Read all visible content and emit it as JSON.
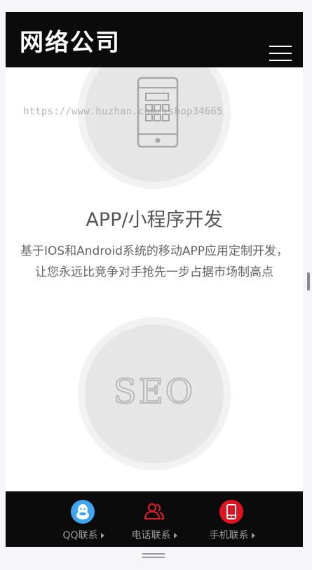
{
  "header": {
    "logo_text": "网络公司"
  },
  "watermark": "https://www.huzhan.com/ishop34665",
  "services": [
    {
      "title": "APP/小程序开发",
      "description": "基于IOS和Android系统的移动APP应用定制开发，让您永远比竞争对手抢先一步占据市场制高点",
      "icon": "mobile-phone-icon"
    },
    {
      "graphic_text": "SEO",
      "icon": "seo-icon"
    }
  ],
  "footer": {
    "items": [
      {
        "label": "QQ联系",
        "icon": "qq-icon",
        "color": "#3ea6f0"
      },
      {
        "label": "电话联系",
        "icon": "contacts-icon",
        "color": "#d4202b"
      },
      {
        "label": "手机联系",
        "icon": "mobile-icon",
        "color": "#e01420"
      }
    ]
  }
}
